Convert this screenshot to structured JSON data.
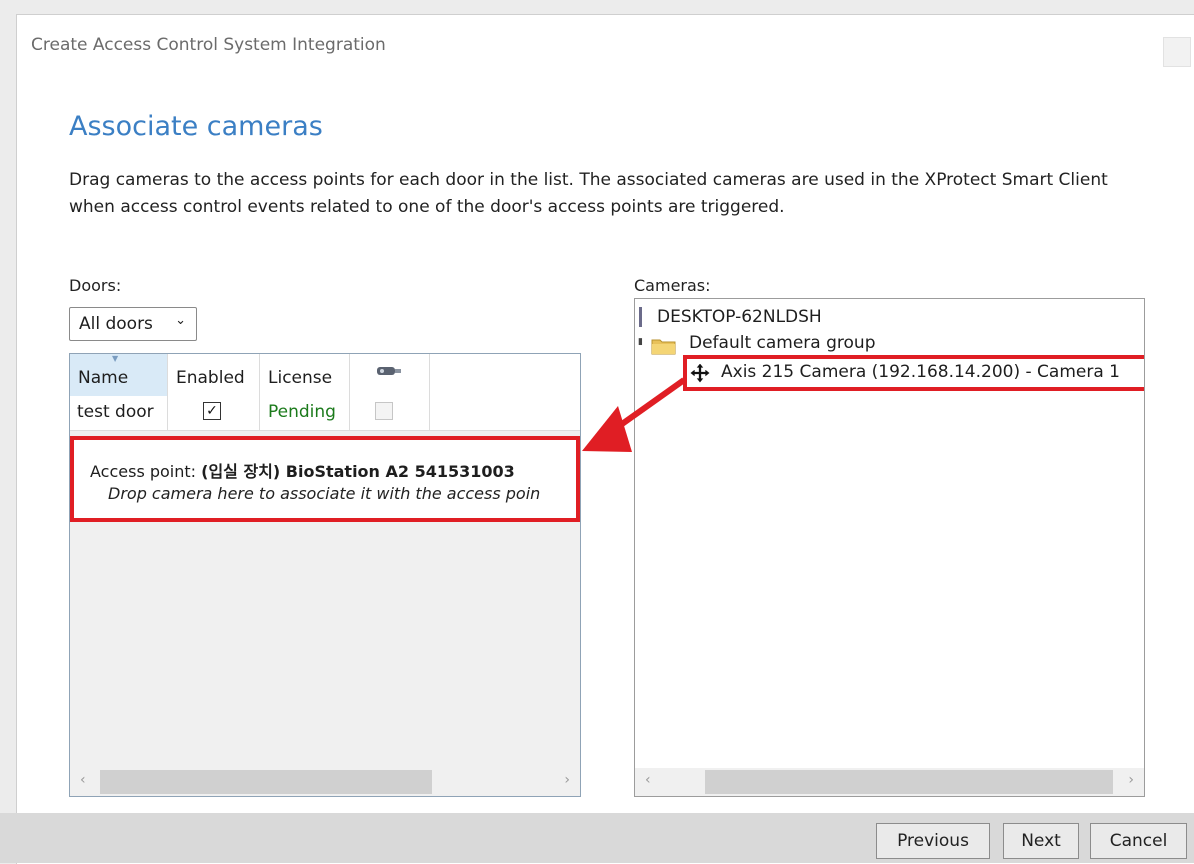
{
  "window": {
    "title": "Create Access Control System Integration"
  },
  "heading": "Associate cameras",
  "description": "Drag cameras to the access points for each door in the list. The associated cameras are used in the XProtect Smart Client when access control events related to one of the door's access points are triggered.",
  "doors": {
    "label": "Doors:",
    "filter_selected": "All doors",
    "columns": {
      "name": "Name",
      "enabled": "Enabled",
      "license": "License",
      "camera": "camera-icon"
    },
    "rows": [
      {
        "name": "test door",
        "enabled": true,
        "license": "Pending",
        "license_color": "#1b7a1b"
      }
    ],
    "access_point": {
      "prefix": "Access point: ",
      "name": "(입실 장치) BioStation A2 541531003",
      "hint": "Drop camera here to associate it with the access poin"
    }
  },
  "cameras": {
    "label": "Cameras:",
    "root": "DESKTOP-62NLDSH",
    "group": "Default camera group",
    "camera": "Axis 215 Camera (192.168.14.200) - Camera 1"
  },
  "highlight_color": "#e01e24",
  "buttons": {
    "previous": "Previous",
    "next": "Next",
    "cancel": "Cancel"
  }
}
